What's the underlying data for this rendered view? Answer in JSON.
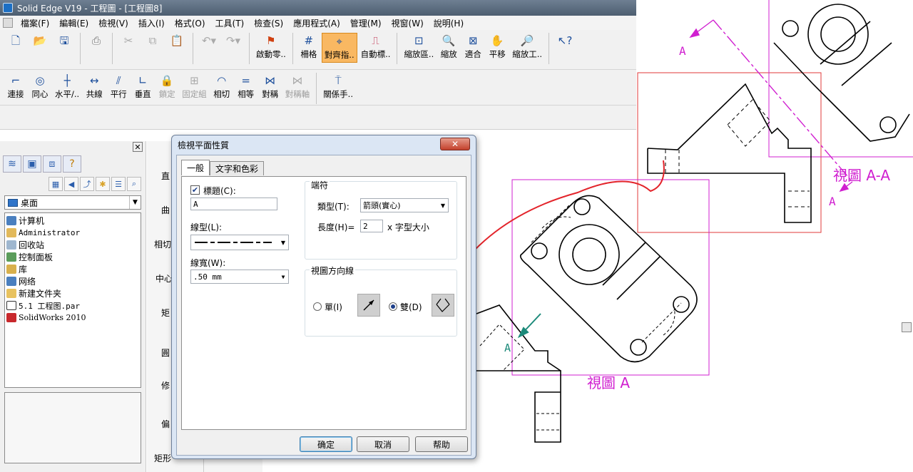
{
  "window": {
    "title": "Solid Edge V19 - 工程圖 - [工程圖8]"
  },
  "menu": [
    "檔案(F)",
    "編輯(E)",
    "檢視(V)",
    "插入(I)",
    "格式(O)",
    "工具(T)",
    "檢查(S)",
    "應用程式(A)",
    "管理(M)",
    "視窗(W)",
    "說明(H)"
  ],
  "toolbar1": {
    "btn_start": "啟動零..",
    "btn_grid": "柵格",
    "btn_align": "對齊指..",
    "btn_autodim": "自動標..",
    "btn_zoom_area": "縮放區..",
    "btn_zoom": "縮放",
    "btn_fit": "適合",
    "btn_pan": "平移",
    "btn_zoom_tool": "縮放工.."
  },
  "toolbar2": {
    "connect": "連接",
    "concentric": "同心",
    "horizontal": "水平/..",
    "collinear": "共線",
    "parallel": "平行",
    "perpendicular": "垂直",
    "lock": "鎖定",
    "rigid": "固定組",
    "tangent": "相切",
    "equal": "相等",
    "symmetric": "對稱",
    "sym_axis": "對稱軸",
    "relations": "關係手.."
  },
  "library": {
    "location": "桌面",
    "items": [
      "计算机",
      "Administrator",
      "回收站",
      "控制面板",
      "库",
      "网络",
      "新建文件夹",
      "5.1 工程图.par",
      "SolidWorks 2010"
    ]
  },
  "sidestrip": [
    "直",
    "曲",
    "相切",
    "中心",
    "矩",
    "圓",
    "修",
    "偏",
    "矩形"
  ],
  "dialog": {
    "title": "檢視平面性質",
    "tabs": [
      "一般",
      "文字和色彩"
    ],
    "caption_label": "標題(C):",
    "caption_value": "A",
    "linetype_label": "線型(L):",
    "linewidth_label": "線寬(W):",
    "linewidth_value": ".50 mm",
    "endpoint_group": "端符",
    "type_label": "類型(T):",
    "type_value": "箭頭(實心)",
    "length_label": "長度(H)=",
    "length_value": "2",
    "length_unit": "x 字型大小",
    "direction_group": "視圖方向線",
    "single_label": "單(I)",
    "double_label": "雙(D)",
    "ok": "确定",
    "cancel": "取消",
    "help": "帮助"
  },
  "drawing": {
    "label_a1": "A",
    "label_a2": "A",
    "label_a3": "A",
    "view_aa": "視圖 A-A",
    "view_a": "視圖 A"
  }
}
